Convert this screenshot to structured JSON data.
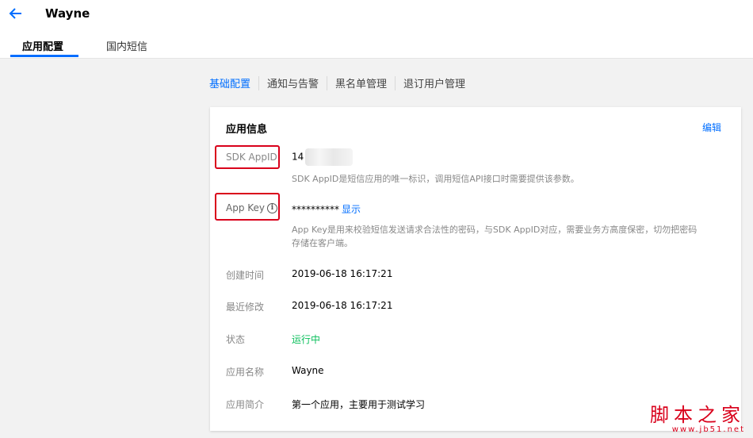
{
  "header": {
    "back_icon": "arrow-left-icon",
    "title": "Wayne",
    "tabs": [
      {
        "label": "应用配置",
        "active": true
      },
      {
        "label": "国内短信",
        "active": false
      }
    ]
  },
  "subnav": {
    "items": [
      {
        "label": "基础配置",
        "active": true
      },
      {
        "label": "通知与告警",
        "active": false
      },
      {
        "label": "黑名单管理",
        "active": false
      },
      {
        "label": "退订用户管理",
        "active": false
      }
    ]
  },
  "card": {
    "title": "应用信息",
    "edit_label": "编辑",
    "sdk_appid": {
      "label": "SDK AppID",
      "value_prefix": "14",
      "desc": "SDK AppID是短信应用的唯一标识，调用短信API接口时需要提供该参数。"
    },
    "app_key": {
      "label": "App Key",
      "info_icon": "info-icon",
      "masked_value": "**********",
      "show_label": "显示",
      "desc_line1": "App Key是用来校验短信发送请求合法性的密码，与SDK AppID对应，需要业务方高度保密，切勿把密码",
      "desc_line2": "存储在客户端。"
    },
    "created": {
      "label": "创建时间",
      "value": "2019-06-18 16:17:21"
    },
    "modified": {
      "label": "最近修改",
      "value": "2019-06-18 16:17:21"
    },
    "status": {
      "label": "状态",
      "value": "运行中"
    },
    "app_name": {
      "label": "应用名称",
      "value": "Wayne"
    },
    "app_intro": {
      "label": "应用简介",
      "value": "第一个应用，主要用于测试学习"
    }
  },
  "watermark": {
    "main": "脚本之家",
    "sub": "www.jb51.net"
  },
  "colors": {
    "accent": "#006eff",
    "status_running": "#0abf5b",
    "highlight_box": "#d9001b"
  }
}
